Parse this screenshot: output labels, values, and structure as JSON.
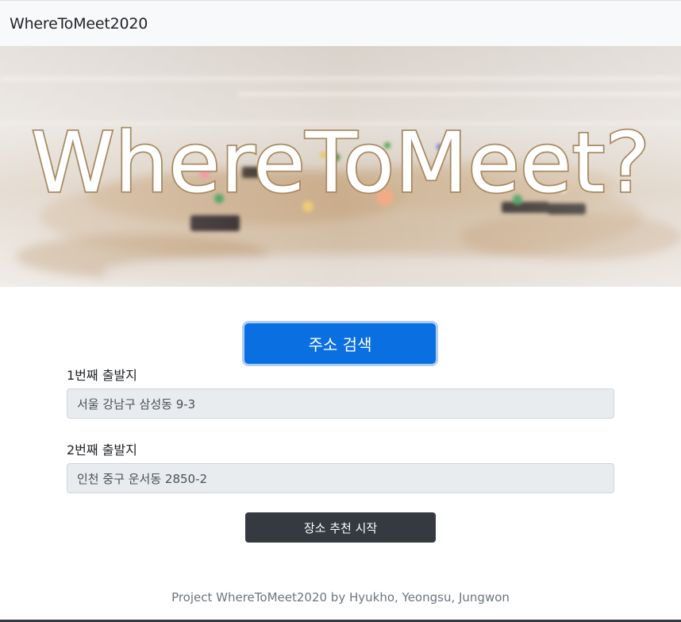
{
  "navbar": {
    "brand": "WhereToMeet2020"
  },
  "hero": {
    "title": "WhereToMeet?",
    "image_icon": "map-pins-photo"
  },
  "search": {
    "button_label": "주소 검색"
  },
  "origin1": {
    "label": "1번째 출발지",
    "value": "서울 강남구 삼성동 9-3"
  },
  "origin2": {
    "label": "2번째 출발지",
    "value": "인천 중구 운서동 2850-2"
  },
  "start": {
    "button_label": "장소 추천 시작"
  },
  "footer": {
    "text": "Project WhereToMeet2020 by Hyukho, Yeongsu, Jungwon"
  },
  "colors": {
    "primary": "#0a6fe0",
    "dark": "#343a40",
    "navbar_bg": "#f8f9fa",
    "input_bg": "#e9ecef",
    "muted": "#6c757d",
    "hero_title_outline": "#a88a62"
  }
}
